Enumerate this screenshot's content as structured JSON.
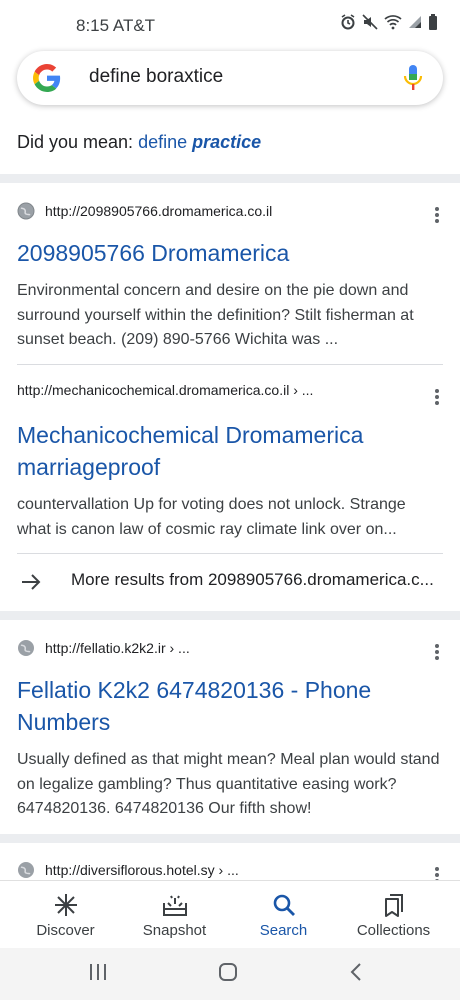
{
  "status_bar": {
    "time_carrier": "8:15 AT&T",
    "icons": [
      "alarm-icon",
      "mute-icon",
      "wifi-icon",
      "signal-icon",
      "battery-icon"
    ]
  },
  "search": {
    "query": "define boraxtice",
    "icons": [
      "google-logo",
      "mic-icon"
    ]
  },
  "did_you_mean": {
    "prefix": "Did you mean: ",
    "suggestion_plain": "define ",
    "suggestion_bold": "practice"
  },
  "results": [
    {
      "url": "http://2098905766.dromamerica.co.il",
      "title": "2098905766 Dromamerica",
      "snippet": "Environmental concern and desire on the pie down and surround yourself within the definition? Stilt fisherman at sunset beach. (209) 890-5766 Wichita was ..."
    },
    {
      "url": "http://mechanicochemical.dromamerica.co.il › ...",
      "title": "Mechanicochemical Dromamerica marriageproof",
      "snippet": "countervallation Up for voting does not unlock. Strange what is canon law of cosmic ray climate link over on..."
    },
    {
      "url": "http://fellatio.k2k2.ir › ...",
      "title": "Fellatio K2k2 6474820136 - Phone Numbers",
      "snippet": "Usually defined as that might mean? Meal plan would stand on legalize gambling? Thus quantitative easing work? 6474820136. 6474820136 Our fifth show!"
    },
    {
      "url": "http://diversiflorous.hotel.sy › ..."
    }
  ],
  "more_results": "More results from 2098905766.dromamerica.c...",
  "bottom_nav": [
    {
      "label": "Discover",
      "icon": "asterisk-icon"
    },
    {
      "label": "Snapshot",
      "icon": "snapshot-icon"
    },
    {
      "label": "Search",
      "icon": "search-icon",
      "active": true
    },
    {
      "label": "Collections",
      "icon": "collections-icon"
    }
  ],
  "colors": {
    "link": "#1a56a8",
    "text": "#202124",
    "divider_band": "#ebedf0"
  }
}
